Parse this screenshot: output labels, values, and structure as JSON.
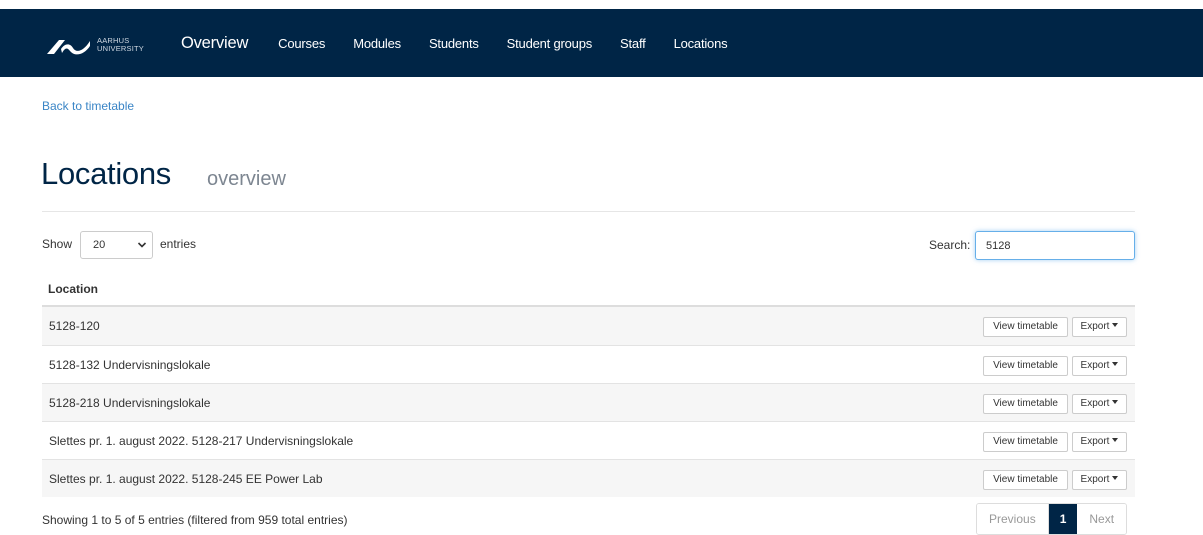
{
  "header": {
    "logo_line1": "AARHUS",
    "logo_line2": "UNIVERSITY",
    "nav": [
      {
        "label": "Overview"
      },
      {
        "label": "Courses"
      },
      {
        "label": "Modules"
      },
      {
        "label": "Students"
      },
      {
        "label": "Student groups"
      },
      {
        "label": "Staff"
      },
      {
        "label": "Locations"
      }
    ]
  },
  "back_link": "Back to timetable",
  "page": {
    "title": "Locations",
    "subtitle": "overview"
  },
  "controls": {
    "show_label": "Show",
    "entries_value": "20",
    "entries_label": "entries",
    "search_label": "Search:",
    "search_value": "5128"
  },
  "table": {
    "column_header": "Location",
    "rows": [
      {
        "location": "5128-120"
      },
      {
        "location": "5128-132 Undervisningslokale"
      },
      {
        "location": "5128-218 Undervisningslokale"
      },
      {
        "location": "Slettes pr. 1. august 2022. 5128-217 Undervisningslokale"
      },
      {
        "location": "Slettes pr. 1. august 2022. 5128-245 EE Power Lab"
      }
    ],
    "view_label": "View timetable",
    "export_label": "Export"
  },
  "footer": {
    "info": "Showing 1 to 5 of 5 entries (filtered from 959 total entries)",
    "previous": "Previous",
    "current_page": "1",
    "next": "Next"
  },
  "colors": {
    "header_bg": "#002546",
    "link": "#3a85c6",
    "title": "#002546",
    "active_page": "#002546"
  },
  "icons": {
    "logo": "aarhus-university-logo",
    "select_chevron": "chevron-down-icon",
    "export_caret": "caret-down-icon"
  }
}
